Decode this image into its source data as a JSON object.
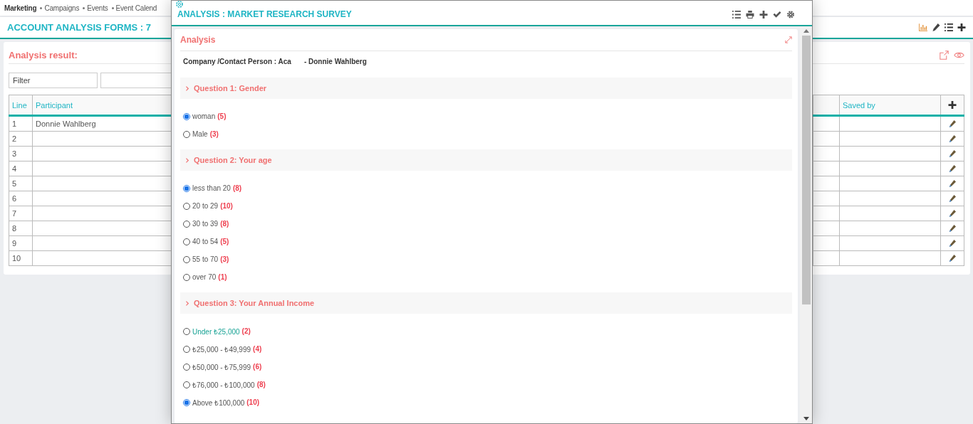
{
  "nav": {
    "items": [
      "Marketing",
      "Campaigns",
      "Events",
      "Event Calend"
    ]
  },
  "header": {
    "title": "ACCOUNT ANALYSIS FORMS : 7"
  },
  "card": {
    "title": "Analysis result:",
    "filter": {
      "placeholder": "Filter"
    },
    "table": {
      "columns": [
        "Line",
        "Participant",
        "",
        "Saved by"
      ],
      "rows": [
        {
          "line": "1",
          "participant": "Donnie Wahlberg"
        },
        {
          "line": "2",
          "participant": ""
        },
        {
          "line": "3",
          "participant": ""
        },
        {
          "line": "4",
          "participant": ""
        },
        {
          "line": "5",
          "participant": ""
        },
        {
          "line": "6",
          "participant": ""
        },
        {
          "line": "7",
          "participant": ""
        },
        {
          "line": "8",
          "participant": ""
        },
        {
          "line": "9",
          "participant": ""
        },
        {
          "line": "10",
          "participant": ""
        }
      ]
    }
  },
  "modal": {
    "title": "ANALYSIS : MARKET RESEARCH SURVEY",
    "section": "Analysis",
    "company_label": "Company /Contact Person : Aca",
    "contact": "- Donnie Wahlberg",
    "questions": [
      {
        "title": "Question 1: Gender",
        "options": [
          {
            "label": "woman",
            "count": "(5)",
            "selected": true,
            "highlighted": false
          },
          {
            "label": "Male",
            "count": "(3)",
            "selected": false,
            "highlighted": false
          }
        ]
      },
      {
        "title": "Question 2: Your age",
        "options": [
          {
            "label": "less than 20",
            "count": "(8)",
            "selected": true,
            "highlighted": false
          },
          {
            "label": "20 to 29",
            "count": "(10)",
            "selected": false,
            "highlighted": false
          },
          {
            "label": "30 to 39",
            "count": "(8)",
            "selected": false,
            "highlighted": false
          },
          {
            "label": "40 to 54",
            "count": "(5)",
            "selected": false,
            "highlighted": false
          },
          {
            "label": "55 to 70",
            "count": "(3)",
            "selected": false,
            "highlighted": false
          },
          {
            "label": "over 70",
            "count": "(1)",
            "selected": false,
            "highlighted": false
          }
        ]
      },
      {
        "title": "Question 3: Your Annual Income",
        "options": [
          {
            "label": "Under ₺25,000",
            "count": "(2)",
            "selected": false,
            "highlighted": true
          },
          {
            "label": "₺25,000 - ₺49,999",
            "count": "(4)",
            "selected": false,
            "highlighted": false
          },
          {
            "label": "₺50,000 - ₺75,999",
            "count": "(6)",
            "selected": false,
            "highlighted": false
          },
          {
            "label": "₺76,000 - ₺100,000",
            "count": "(8)",
            "selected": false,
            "highlighted": false
          },
          {
            "label": "Above ₺100,000",
            "count": "(10)",
            "selected": true,
            "highlighted": false
          }
        ]
      }
    ]
  }
}
